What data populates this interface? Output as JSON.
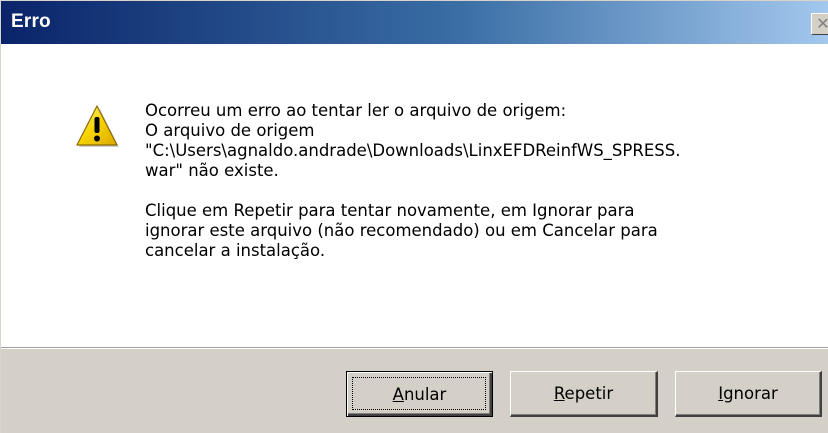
{
  "window": {
    "title": "Erro",
    "close_glyph": "✕"
  },
  "icon": {
    "name": "warning-icon",
    "color": "#f5c400"
  },
  "message": {
    "lines": [
      "Ocorreu um erro ao tentar ler o arquivo de origem:",
      "O arquivo de origem",
      "\"C:\\Users\\agnaldo.andrade\\Downloads\\LinxEFDReinfWS_SPRESS.",
      "war\" não existe."
    ],
    "hint_lines": [
      "Clique em Repetir para tentar novamente, em Ignorar para",
      "ignorar este arquivo (não recomendado) ou em Cancelar para",
      "cancelar a instalação."
    ]
  },
  "buttons": {
    "abort": {
      "mnemonic": "A",
      "rest": "nular"
    },
    "retry": {
      "mnemonic": "R",
      "rest": "epetir"
    },
    "ignore": {
      "mnemonic": "I",
      "rest": "gnorar"
    }
  },
  "colors": {
    "titlebar_start": "#0a246a",
    "titlebar_end": "#a6caf0",
    "face": "#d4d0c8"
  }
}
